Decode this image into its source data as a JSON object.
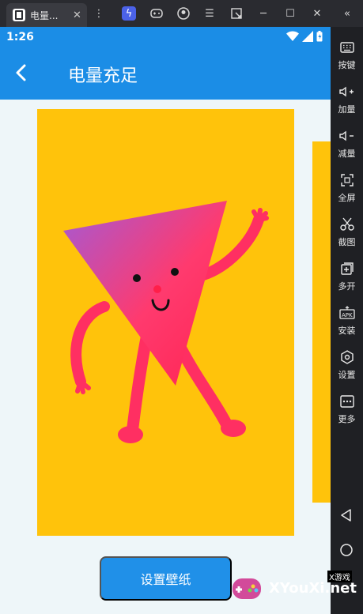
{
  "window": {
    "tab_title": "电量...",
    "tab_close": "✕",
    "toolbar_icons": [
      "more-vert-icon",
      "bolt-icon",
      "gamepad-icon",
      "account-icon",
      "menu-icon",
      "resize-icon",
      "minimize-icon",
      "maximize-icon",
      "close-icon",
      "collapse-icon"
    ]
  },
  "status": {
    "time": "1:26"
  },
  "appbar": {
    "title": "电量充足"
  },
  "main": {
    "set_wallpaper_label": "设置壁纸"
  },
  "sidebar": {
    "items": [
      {
        "label": "按键",
        "icon": "keyboard-icon"
      },
      {
        "label": "加量",
        "icon": "volume-up-icon"
      },
      {
        "label": "减量",
        "icon": "volume-down-icon"
      },
      {
        "label": "全屏",
        "icon": "fullscreen-icon"
      },
      {
        "label": "截图",
        "icon": "scissors-icon"
      },
      {
        "label": "多开",
        "icon": "multi-open-icon"
      },
      {
        "label": "安装",
        "icon": "apk-install-icon"
      },
      {
        "label": "设置",
        "icon": "settings-icon"
      },
      {
        "label": "更多",
        "icon": "more-icon"
      }
    ]
  },
  "watermark": {
    "brand": "XYouXi.net",
    "top_text": "X游戏"
  },
  "colors": {
    "accent": "#1b8de6",
    "wallpaper_bg": "#ffc30b",
    "character": "#ff2f62"
  }
}
